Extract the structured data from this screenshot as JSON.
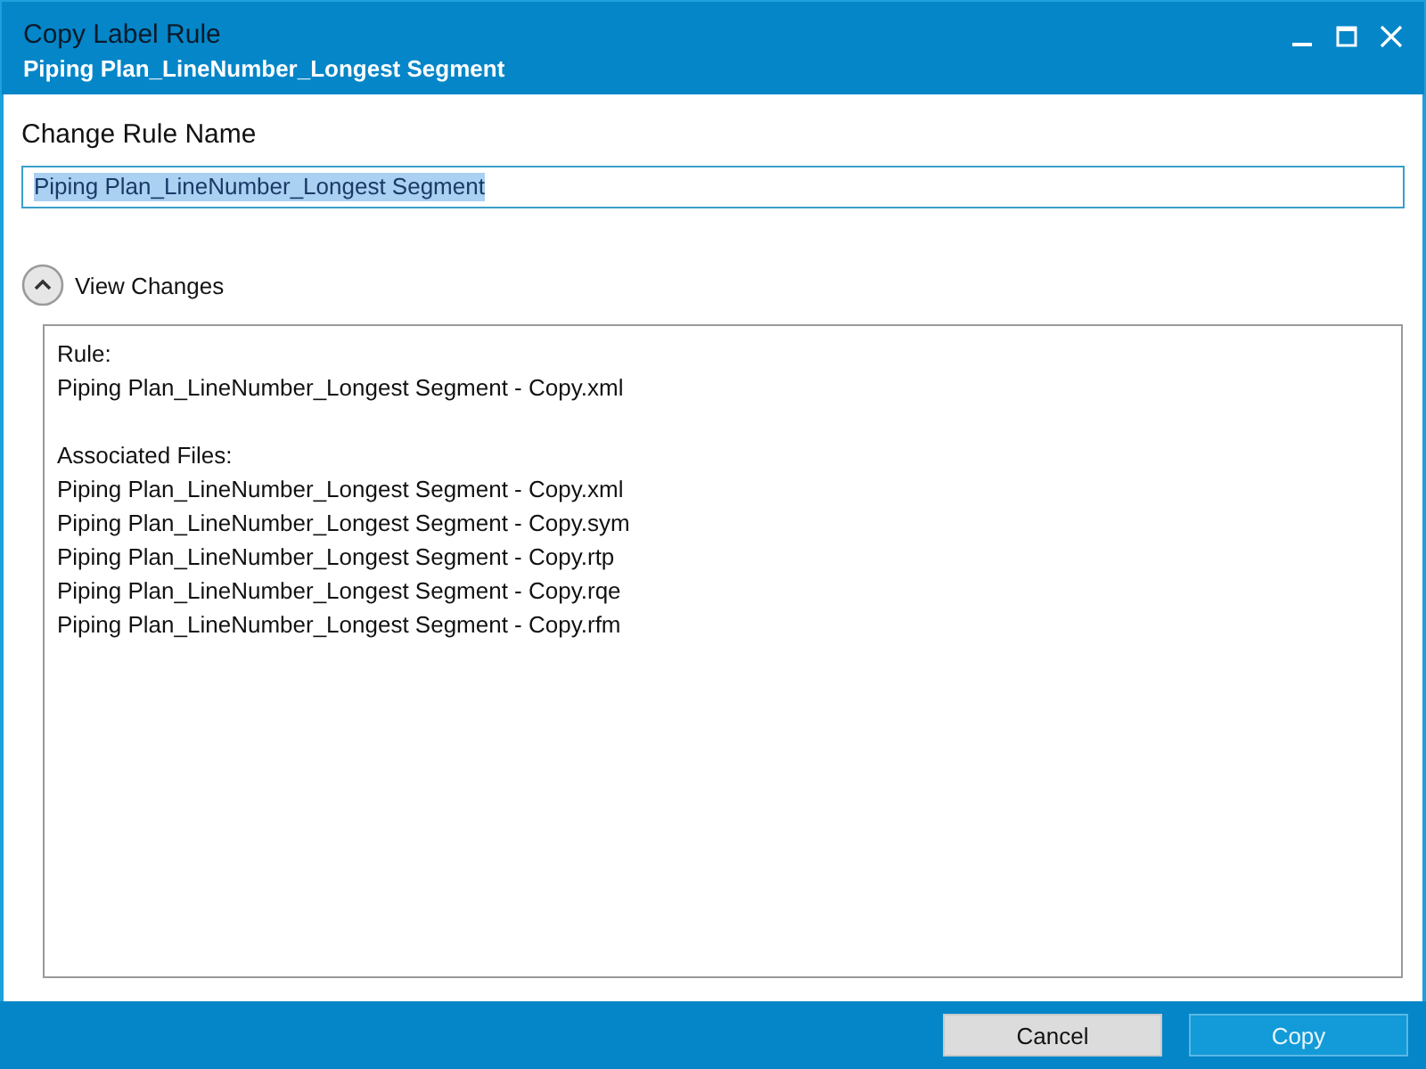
{
  "window": {
    "title": "Copy Label Rule",
    "subtitle": "Piping Plan_LineNumber_Longest Segment"
  },
  "rule_name": {
    "label": "Change Rule Name",
    "value": "Piping Plan_LineNumber_Longest Segment",
    "text_selected": true
  },
  "view_changes": {
    "label": "View Changes",
    "expanded": true
  },
  "changes": [
    {
      "heading": "Rule:",
      "files": [
        "Piping Plan_LineNumber_Longest Segment - Copy.xml"
      ]
    },
    {
      "heading": "Associated Files:",
      "files": [
        "Piping Plan_LineNumber_Longest Segment - Copy.xml",
        "Piping Plan_LineNumber_Longest Segment - Copy.sym",
        "Piping Plan_LineNumber_Longest Segment - Copy.rtp",
        "Piping Plan_LineNumber_Longest Segment - Copy.rqe",
        "Piping Plan_LineNumber_Longest Segment - Copy.rfm"
      ]
    }
  ],
  "buttons": [
    {
      "label": "Cancel",
      "kind": "secondary"
    },
    {
      "label": "Copy",
      "kind": "primary"
    }
  ]
}
